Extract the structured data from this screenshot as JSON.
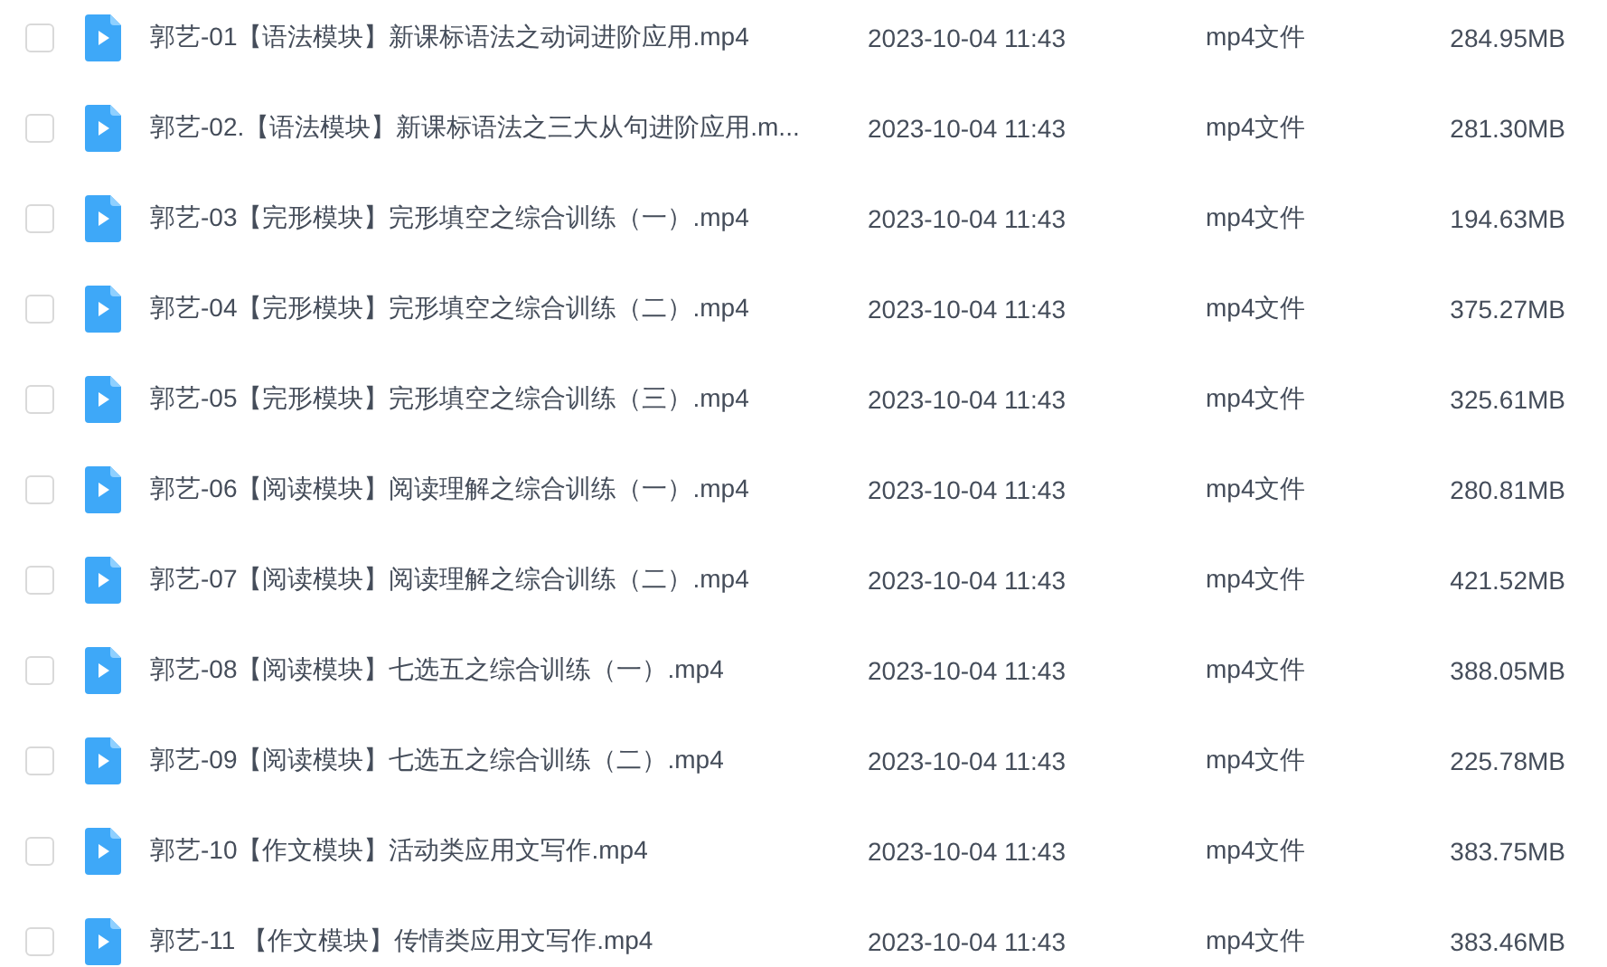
{
  "files": [
    {
      "checked": false,
      "name": "郭艺-01【语法模块】新课标语法之动词进阶应用.mp4",
      "modified": "2023-10-04 11:43",
      "type": "mp4文件",
      "size": "284.95MB"
    },
    {
      "checked": false,
      "name": "郭艺-02.【语法模块】新课标语法之三大从句进阶应用.m...",
      "modified": "2023-10-04 11:43",
      "type": "mp4文件",
      "size": "281.30MB"
    },
    {
      "checked": false,
      "name": "郭艺-03【完形模块】完形填空之综合训练（一）.mp4",
      "modified": "2023-10-04 11:43",
      "type": "mp4文件",
      "size": "194.63MB"
    },
    {
      "checked": false,
      "name": "郭艺-04【完形模块】完形填空之综合训练（二）.mp4",
      "modified": "2023-10-04 11:43",
      "type": "mp4文件",
      "size": "375.27MB"
    },
    {
      "checked": false,
      "name": "郭艺-05【完形模块】完形填空之综合训练（三）.mp4",
      "modified": "2023-10-04 11:43",
      "type": "mp4文件",
      "size": "325.61MB"
    },
    {
      "checked": false,
      "name": "郭艺-06【阅读模块】阅读理解之综合训练（一）.mp4",
      "modified": "2023-10-04 11:43",
      "type": "mp4文件",
      "size": "280.81MB"
    },
    {
      "checked": false,
      "name": "郭艺-07【阅读模块】阅读理解之综合训练（二）.mp4",
      "modified": "2023-10-04 11:43",
      "type": "mp4文件",
      "size": "421.52MB"
    },
    {
      "checked": false,
      "name": "郭艺-08【阅读模块】七选五之综合训练（一）.mp4",
      "modified": "2023-10-04 11:43",
      "type": "mp4文件",
      "size": "388.05MB"
    },
    {
      "checked": false,
      "name": "郭艺-09【阅读模块】七选五之综合训练（二）.mp4",
      "modified": "2023-10-04 11:43",
      "type": "mp4文件",
      "size": "225.78MB"
    },
    {
      "checked": false,
      "name": "郭艺-10【作文模块】活动类应用文写作.mp4",
      "modified": "2023-10-04 11:43",
      "type": "mp4文件",
      "size": "383.75MB"
    },
    {
      "checked": false,
      "name": "郭艺-11 【作文模块】传情类应用文写作.mp4",
      "modified": "2023-10-04 11:43",
      "type": "mp4文件",
      "size": "383.46MB"
    }
  ]
}
